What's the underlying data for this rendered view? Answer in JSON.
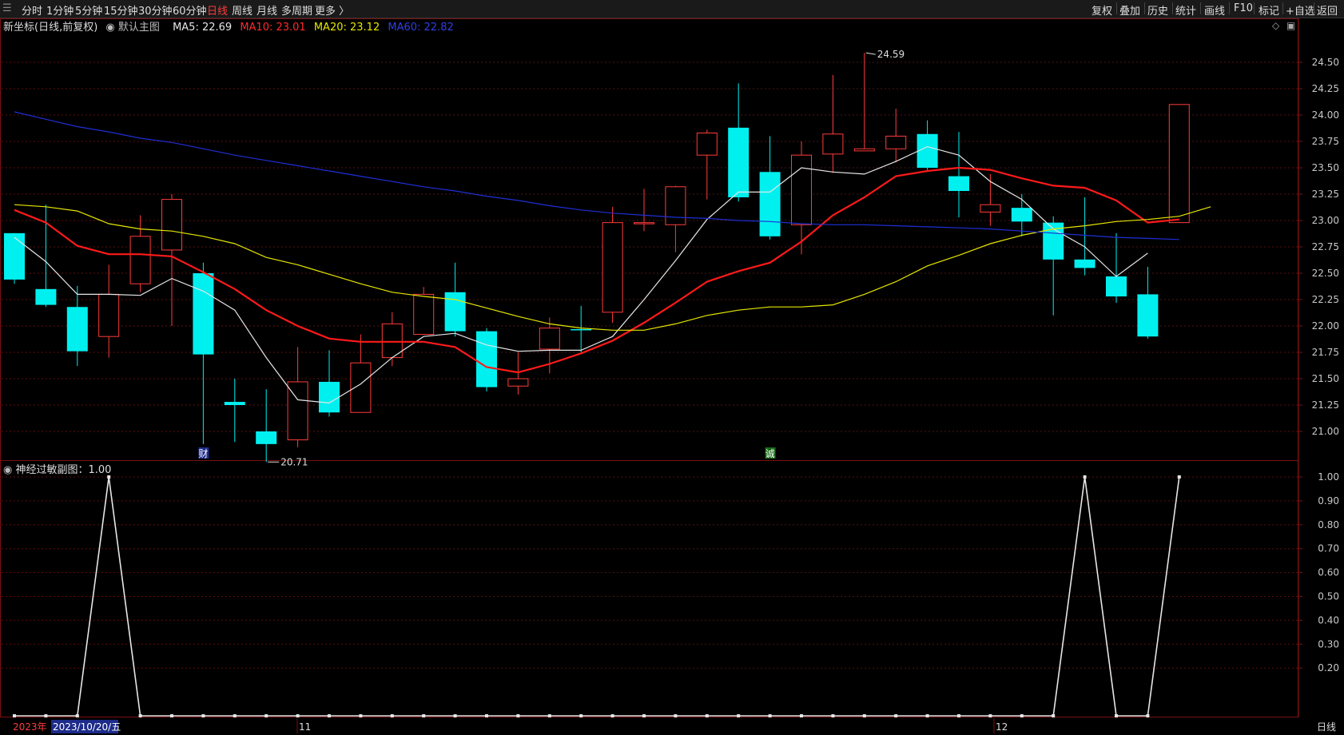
{
  "topbar": {
    "timeframes": [
      "分时",
      "1分钟",
      "5分钟",
      "15分钟",
      "30分钟",
      "60分钟",
      "日线",
      "周线",
      "月线",
      "多周期",
      "更多 〉"
    ],
    "active_timeframe": "日线",
    "right_buttons": [
      "复权",
      "叠加",
      "历史",
      "统计",
      "画线",
      "F10",
      "标记",
      "+自选",
      "返回"
    ]
  },
  "legend": {
    "title": "新坐标(日线,前复权)",
    "main_chart": "默认主图",
    "ma5": "MA5: 22.69",
    "ma10": "MA10: 23.01",
    "ma20": "MA20: 23.12",
    "ma60": "MA60: 22.82"
  },
  "colors": {
    "up": "#ff3b3b",
    "down": "#00f0f0",
    "ma5": "#e6e6e6",
    "ma10": "#ff1a1a",
    "ma20": "#e6e600",
    "ma60": "#1f2fd6",
    "grid": "#5a0f0f",
    "axis_text": "#c8c8c8"
  },
  "subchart": {
    "title": "神经过敏副图：1.00"
  },
  "annotations": {
    "high": "24.59",
    "low": "20.71",
    "marker1": "财",
    "marker2": "诚"
  },
  "bottom": {
    "year": "2023年",
    "date": "2023/10/20/五",
    "month11": "11",
    "month12": "12",
    "period": "日线"
  },
  "chart_data": [
    {
      "type": "candlestick",
      "ylim": [
        20.55,
        24.7
      ],
      "y_ticks": [
        "24.50",
        "24.25",
        "24.00",
        "23.75",
        "23.50",
        "23.25",
        "23.00",
        "22.75",
        "22.50",
        "22.25",
        "22.00",
        "21.75",
        "21.50",
        "21.25",
        "21.00"
      ],
      "candles": [
        {
          "o": 22.88,
          "h": 22.88,
          "l": 22.4,
          "c": 22.44
        },
        {
          "o": 22.35,
          "h": 23.15,
          "l": 22.18,
          "c": 22.2
        },
        {
          "o": 22.18,
          "h": 22.38,
          "l": 21.62,
          "c": 21.76
        },
        {
          "o": 21.9,
          "h": 22.58,
          "l": 21.7,
          "c": 22.3
        },
        {
          "o": 22.4,
          "h": 23.05,
          "l": 22.32,
          "c": 22.85
        },
        {
          "o": 22.72,
          "h": 23.25,
          "l": 22.0,
          "c": 23.2
        },
        {
          "o": 22.5,
          "h": 22.6,
          "l": 20.88,
          "c": 21.73
        },
        {
          "o": 21.28,
          "h": 21.5,
          "l": 20.9,
          "c": 21.25
        },
        {
          "o": 21.0,
          "h": 21.4,
          "l": 20.71,
          "c": 20.88
        },
        {
          "o": 20.92,
          "h": 21.8,
          "l": 20.85,
          "c": 21.47
        },
        {
          "o": 21.47,
          "h": 21.77,
          "l": 21.14,
          "c": 21.18
        },
        {
          "o": 21.18,
          "h": 21.92,
          "l": 21.18,
          "c": 21.65
        },
        {
          "o": 21.7,
          "h": 22.13,
          "l": 21.62,
          "c": 22.02
        },
        {
          "o": 21.92,
          "h": 22.37,
          "l": 21.92,
          "c": 22.3
        },
        {
          "o": 22.32,
          "h": 22.6,
          "l": 21.9,
          "c": 21.95
        },
        {
          "o": 21.95,
          "h": 21.98,
          "l": 21.38,
          "c": 21.42
        },
        {
          "o": 21.43,
          "h": 21.75,
          "l": 21.35,
          "c": 21.5
        },
        {
          "o": 21.78,
          "h": 22.08,
          "l": 21.55,
          "c": 21.98
        },
        {
          "o": 21.97,
          "h": 22.19,
          "l": 21.75,
          "c": 21.96
        },
        {
          "o": 22.13,
          "h": 23.13,
          "l": 22.03,
          "c": 22.98
        },
        {
          "o": 22.98,
          "h": 23.3,
          "l": 22.9,
          "c": 22.98
        },
        {
          "o": 22.96,
          "h": 23.33,
          "l": 22.7,
          "c": 23.32
        },
        {
          "o": 23.62,
          "h": 23.86,
          "l": 23.2,
          "c": 23.83
        },
        {
          "o": 23.88,
          "h": 24.3,
          "l": 23.18,
          "c": 23.22
        },
        {
          "o": 23.46,
          "h": 23.8,
          "l": 22.82,
          "c": 22.85
        },
        {
          "o": 22.96,
          "h": 23.75,
          "l": 22.68,
          "c": 23.62
        },
        {
          "o": 23.63,
          "h": 24.38,
          "l": 23.45,
          "c": 23.82
        },
        {
          "o": 23.66,
          "h": 24.59,
          "l": 23.66,
          "c": 23.68
        },
        {
          "o": 23.68,
          "h": 24.06,
          "l": 23.55,
          "c": 23.8
        },
        {
          "o": 23.82,
          "h": 23.95,
          "l": 23.48,
          "c": 23.5
        },
        {
          "o": 23.42,
          "h": 23.84,
          "l": 23.03,
          "c": 23.28
        },
        {
          "o": 23.08,
          "h": 23.44,
          "l": 22.95,
          "c": 23.15
        },
        {
          "o": 23.12,
          "h": 23.25,
          "l": 22.85,
          "c": 22.99
        },
        {
          "o": 22.98,
          "h": 23.04,
          "l": 22.1,
          "c": 22.63
        },
        {
          "o": 22.63,
          "h": 23.22,
          "l": 22.48,
          "c": 22.55
        },
        {
          "o": 22.47,
          "h": 22.88,
          "l": 22.22,
          "c": 22.28
        },
        {
          "o": 22.3,
          "h": 22.56,
          "l": 21.88,
          "c": 21.9
        },
        {
          "o": 22.98,
          "h": 24.1,
          "l": 22.98,
          "c": 24.1
        }
      ],
      "series": [
        {
          "name": "MA5",
          "values": [
            22.84,
            22.61,
            22.3,
            22.3,
            22.29,
            22.45,
            22.33,
            22.15,
            21.7,
            21.3,
            21.27,
            21.45,
            21.7,
            21.9,
            21.93,
            21.82,
            21.76,
            21.77,
            21.77,
            21.9,
            22.25,
            22.62,
            23.01,
            23.27,
            23.27,
            23.5,
            23.46,
            23.44,
            23.56,
            23.7,
            23.62,
            23.37,
            23.2,
            22.92,
            22.75,
            22.47,
            22.69
          ]
        },
        {
          "name": "MA10",
          "values": [
            23.1,
            22.98,
            22.76,
            22.68,
            22.68,
            22.66,
            22.51,
            22.35,
            22.15,
            22.0,
            21.88,
            21.85,
            21.85,
            21.85,
            21.8,
            21.61,
            21.56,
            21.64,
            21.74,
            21.86,
            22.03,
            22.22,
            22.42,
            22.52,
            22.6,
            22.8,
            23.05,
            23.22,
            23.42,
            23.47,
            23.5,
            23.48,
            23.4,
            23.33,
            23.31,
            23.19,
            22.98,
            23.01
          ]
        },
        {
          "name": "MA20",
          "values": [
            23.15,
            23.13,
            23.09,
            22.97,
            22.92,
            22.9,
            22.85,
            22.78,
            22.65,
            22.58,
            22.49,
            22.4,
            22.32,
            22.28,
            22.25,
            22.17,
            22.09,
            22.02,
            21.98,
            21.96,
            21.96,
            22.02,
            22.1,
            22.15,
            22.18,
            22.18,
            22.2,
            22.3,
            22.42,
            22.57,
            22.67,
            22.78,
            22.86,
            22.92,
            22.95,
            22.99,
            23.01,
            23.04,
            23.13
          ]
        },
        {
          "name": "MA60",
          "values": [
            24.03,
            23.96,
            23.89,
            23.84,
            23.78,
            23.74,
            23.68,
            23.62,
            23.57,
            23.52,
            23.47,
            23.42,
            23.37,
            23.32,
            23.28,
            23.23,
            23.19,
            23.14,
            23.1,
            23.07,
            23.05,
            23.03,
            23.02,
            23.0,
            22.99,
            22.97,
            22.96,
            22.96,
            22.95,
            22.94,
            22.93,
            22.92,
            22.9,
            22.88,
            22.86,
            22.84,
            22.83,
            22.82
          ]
        }
      ]
    },
    {
      "type": "line",
      "name": "神经过敏副图",
      "ylim": [
        0,
        1.05
      ],
      "y_ticks": [
        "1.00",
        "0.90",
        "0.80",
        "0.70",
        "0.60",
        "0.50",
        "0.40",
        "0.30",
        "0.20"
      ],
      "values": [
        0,
        0,
        0,
        1,
        0,
        0,
        0,
        0,
        0,
        0,
        0,
        0,
        0,
        0,
        0,
        0,
        0,
        0,
        0,
        0,
        0,
        0,
        0,
        0,
        0,
        0,
        0,
        0,
        0,
        0,
        0,
        0,
        0,
        0,
        1,
        0,
        0,
        1
      ]
    }
  ]
}
